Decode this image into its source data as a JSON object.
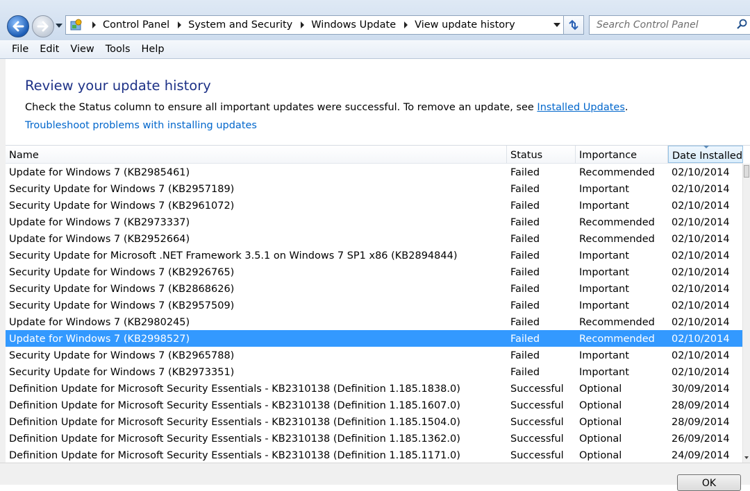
{
  "window": {
    "caption_buttons": [
      "minimize-icon",
      "maximize-icon",
      "close-icon"
    ]
  },
  "navigation": {
    "breadcrumbs": [
      "Control Panel",
      "System and Security",
      "Windows Update",
      "View update history"
    ],
    "search_placeholder": "Search Control Panel"
  },
  "menu": {
    "items": [
      "File",
      "Edit",
      "View",
      "Tools",
      "Help"
    ]
  },
  "page": {
    "title": "Review your update history",
    "description_prefix": "Check the Status column to ensure all important updates were successful. To remove an update, see ",
    "installed_updates_link": "Installed Updates",
    "description_suffix": ".",
    "troubleshoot_link": "Troubleshoot problems with installing updates"
  },
  "table": {
    "columns": [
      "Name",
      "Status",
      "Importance",
      "Date Installed"
    ],
    "sorted_column": "Date Installed",
    "selected_row_index": 10,
    "rows": [
      {
        "name": "Update for Windows 7 (KB2985461)",
        "status": "Failed",
        "importance": "Recommended",
        "date": "02/10/2014"
      },
      {
        "name": "Security Update for Windows 7 (KB2957189)",
        "status": "Failed",
        "importance": "Important",
        "date": "02/10/2014"
      },
      {
        "name": "Security Update for Windows 7 (KB2961072)",
        "status": "Failed",
        "importance": "Important",
        "date": "02/10/2014"
      },
      {
        "name": "Update for Windows 7 (KB2973337)",
        "status": "Failed",
        "importance": "Recommended",
        "date": "02/10/2014"
      },
      {
        "name": "Update for Windows 7 (KB2952664)",
        "status": "Failed",
        "importance": "Recommended",
        "date": "02/10/2014"
      },
      {
        "name": "Security Update for Microsoft .NET Framework 3.5.1 on Windows 7 SP1 x86 (KB2894844)",
        "status": "Failed",
        "importance": "Important",
        "date": "02/10/2014"
      },
      {
        "name": "Security Update for Windows 7 (KB2926765)",
        "status": "Failed",
        "importance": "Important",
        "date": "02/10/2014"
      },
      {
        "name": "Security Update for Windows 7 (KB2868626)",
        "status": "Failed",
        "importance": "Important",
        "date": "02/10/2014"
      },
      {
        "name": "Security Update for Windows 7 (KB2957509)",
        "status": "Failed",
        "importance": "Important",
        "date": "02/10/2014"
      },
      {
        "name": "Update for Windows 7 (KB2980245)",
        "status": "Failed",
        "importance": "Recommended",
        "date": "02/10/2014"
      },
      {
        "name": "Update for Windows 7 (KB2998527)",
        "status": "Failed",
        "importance": "Recommended",
        "date": "02/10/2014"
      },
      {
        "name": "Security Update for Windows 7 (KB2965788)",
        "status": "Failed",
        "importance": "Important",
        "date": "02/10/2014"
      },
      {
        "name": "Security Update for Windows 7 (KB2973351)",
        "status": "Failed",
        "importance": "Important",
        "date": "02/10/2014"
      },
      {
        "name": "Definition Update for Microsoft Security Essentials - KB2310138 (Definition 1.185.1838.0)",
        "status": "Successful",
        "importance": "Optional",
        "date": "30/09/2014"
      },
      {
        "name": "Definition Update for Microsoft Security Essentials - KB2310138 (Definition 1.185.1607.0)",
        "status": "Successful",
        "importance": "Optional",
        "date": "28/09/2014"
      },
      {
        "name": "Definition Update for Microsoft Security Essentials - KB2310138 (Definition 1.185.1504.0)",
        "status": "Successful",
        "importance": "Optional",
        "date": "28/09/2014"
      },
      {
        "name": "Definition Update for Microsoft Security Essentials - KB2310138 (Definition 1.185.1362.0)",
        "status": "Successful",
        "importance": "Optional",
        "date": "26/09/2014"
      },
      {
        "name": "Definition Update for Microsoft Security Essentials - KB2310138 (Definition 1.185.1171.0)",
        "status": "Successful",
        "importance": "Optional",
        "date": "24/09/2014"
      }
    ]
  },
  "footer": {
    "ok_label": "OK"
  },
  "colors": {
    "selection": "#3399ff",
    "heading": "#1e3287",
    "link": "#0066cc"
  }
}
